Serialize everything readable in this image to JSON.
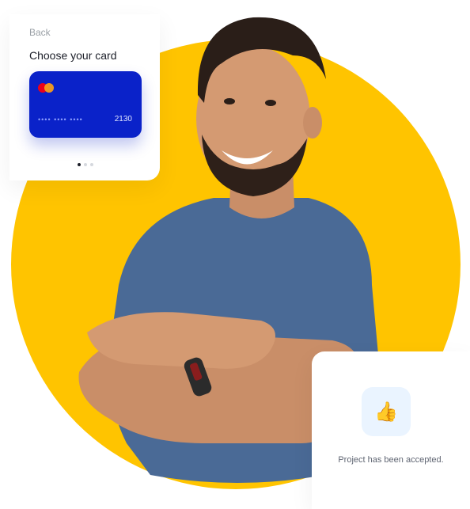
{
  "card_chooser": {
    "back_label": "Back",
    "title": "Choose your card",
    "card": {
      "masked_number": "••••  ••••  ••••",
      "last_four": "2130",
      "brand_icon": "mastercard-icon",
      "color": "#0A22C9"
    },
    "pager": {
      "pages": 3,
      "active_index": 0
    }
  },
  "notification": {
    "icon": "thumbs-up-icon",
    "icon_glyph": "👍",
    "message": "Project has been accepted."
  },
  "colors": {
    "accent_yellow": "#FFC400",
    "card_blue": "#0A22C9",
    "shirt_blue": "#4A6A96"
  }
}
